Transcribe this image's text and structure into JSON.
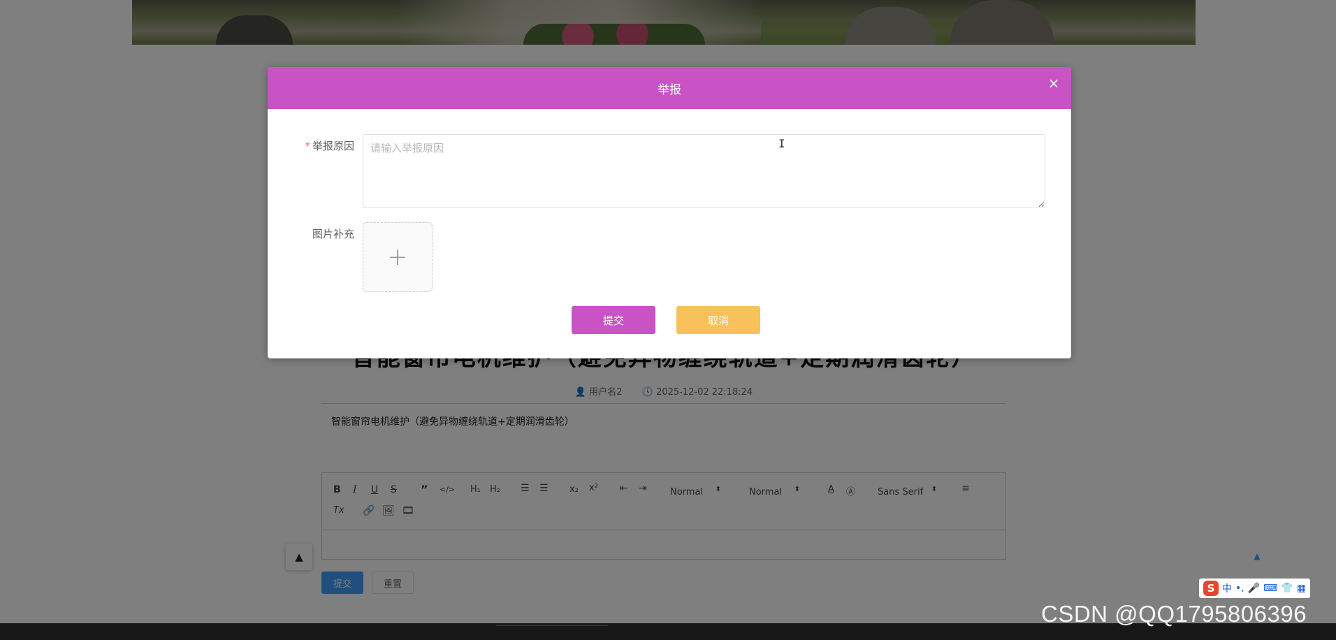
{
  "dialog": {
    "title": "举报",
    "close_symbol": "×",
    "reason_label": "举报原因",
    "reason_required_mark": "*",
    "reason_placeholder": "请输入举报原因",
    "reason_value": "",
    "image_label": "图片补充",
    "submit_label": "提交",
    "cancel_label": "取消",
    "accent_color": "#c952c4",
    "cancel_color": "#f8c15b"
  },
  "background_page": {
    "article_title": "智能窗帘电机维护（避免异物缠绕轨道+定期润滑齿轮）",
    "author": "用户名2",
    "timestamp": "2025-12-02 22:18:24",
    "article_content": "智能窗帘电机维护（避免异物缠绕轨道+定期润滑齿轮）",
    "editor": {
      "header_select": "Normal",
      "size_select": "Normal",
      "font_select": "Sans Serif"
    },
    "submit_label": "提交",
    "reset_label": "重置"
  },
  "ime_toolbar": {
    "logo": "S",
    "mode": "中"
  },
  "watermark": "CSDN @QQ1795806396"
}
